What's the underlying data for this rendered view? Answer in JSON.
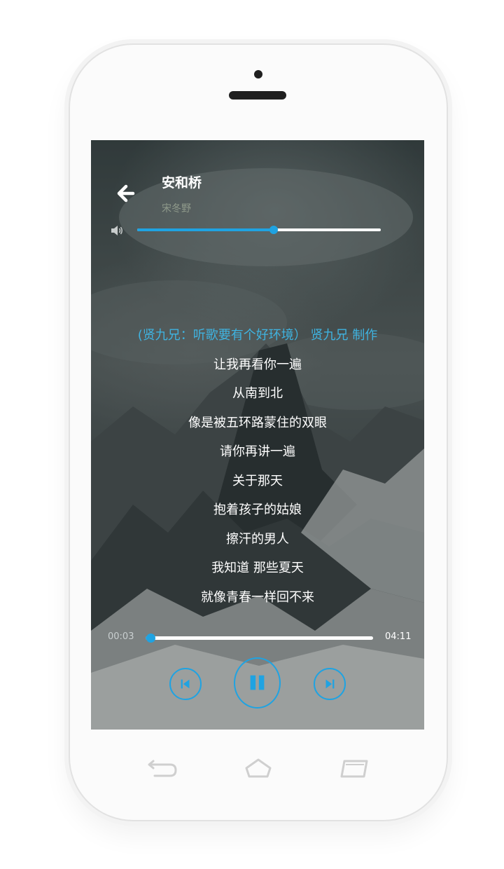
{
  "song": {
    "title": "安和桥",
    "artist": "宋冬野"
  },
  "volume": {
    "level_fraction": 0.56,
    "icon": "volume-icon"
  },
  "lyrics": {
    "lines": [
      "(贤九兄：听歌要有个好环境） 贤九兄 制作",
      "让我再看你一遍",
      "从南到北",
      "像是被五环路蒙住的双眼",
      "请你再讲一遍",
      "关于那天",
      "抱着孩子的姑娘",
      "擦汗的男人",
      "我知道 那些夏天",
      "就像青春一样回不来"
    ],
    "active_index": 0
  },
  "progress": {
    "current": "00:03",
    "total": "04:11",
    "fraction": 0.02
  },
  "controls": {
    "prev_icon": "skip-previous-icon",
    "pause_icon": "pause-icon",
    "next_icon": "skip-next-icon"
  },
  "colors": {
    "accent": "#1fa3e2",
    "active_lyric": "#3fb3e0",
    "artist": "#8f9a8b"
  }
}
